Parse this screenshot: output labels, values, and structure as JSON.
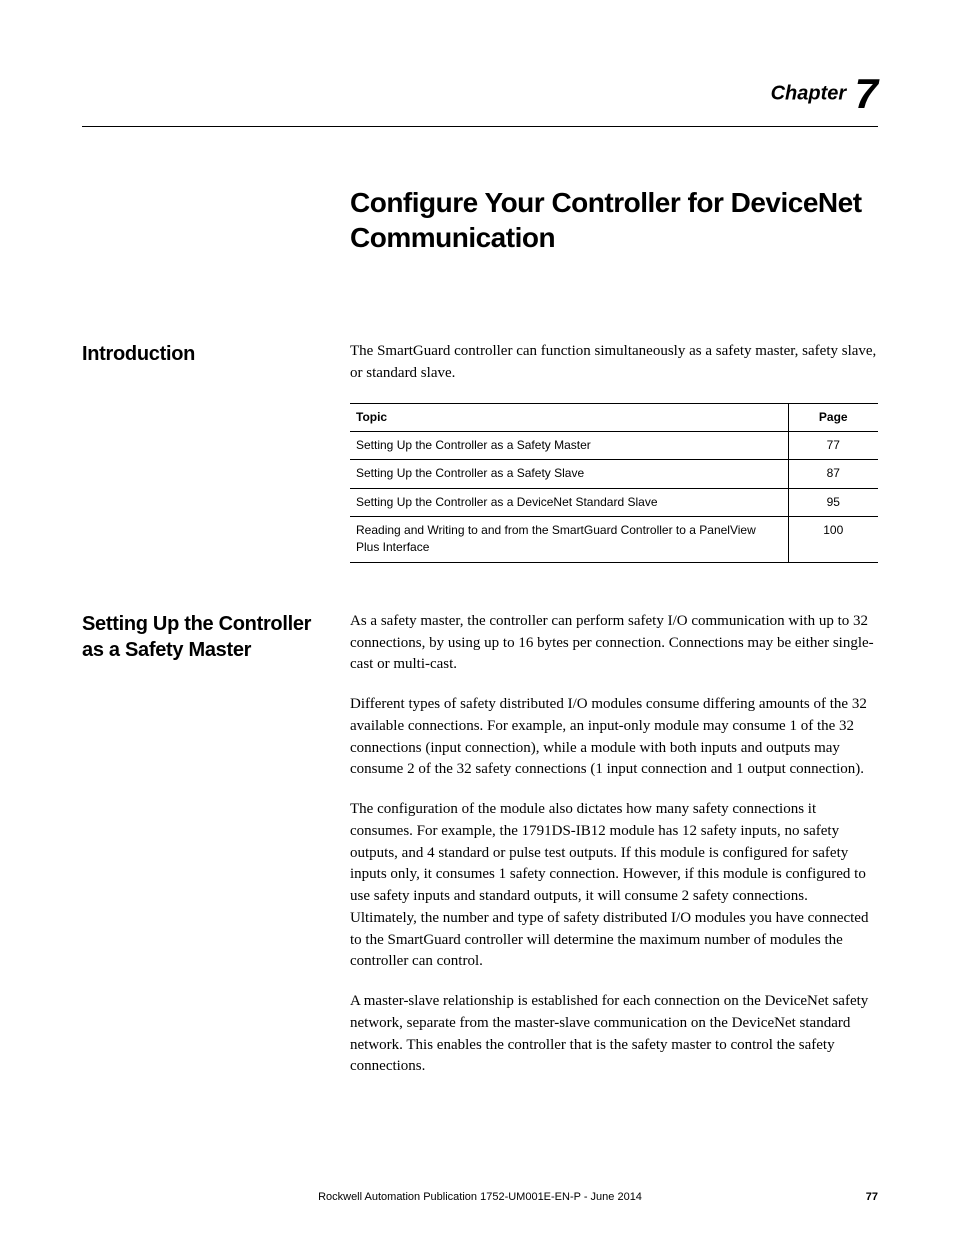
{
  "chapter": {
    "label": "Chapter",
    "number": "7"
  },
  "title": "Configure Your Controller for DeviceNet Communication",
  "intro": {
    "heading": "Introduction",
    "text": "The SmartGuard controller can function simultaneously as a safety master, safety slave, or standard slave.",
    "table": {
      "headers": {
        "topic": "Topic",
        "page": "Page"
      },
      "rows": [
        {
          "topic": "Setting Up the Controller as a Safety Master",
          "page": "77"
        },
        {
          "topic": "Setting Up the Controller as a Safety Slave",
          "page": "87"
        },
        {
          "topic": "Setting Up the Controller as a DeviceNet Standard Slave",
          "page": "95"
        },
        {
          "topic": "Reading and Writing to and from the SmartGuard Controller to a PanelView Plus Interface",
          "page": "100"
        }
      ]
    }
  },
  "section1": {
    "heading": "Setting Up the Controller as a Safety Master",
    "p1": "As a safety master, the controller can perform safety I/O communication with up to 32 connections, by using up to 16 bytes per connection. Connections may be either single-cast or multi-cast.",
    "p2": "Different types of safety distributed I/O modules consume differing amounts of the 32 available connections. For example, an input-only module may consume 1 of the 32 connections (input connection), while a module with both inputs and outputs may consume 2 of the 32 safety connections (1 input connection and 1 output connection).",
    "p3": "The configuration of the module also dictates how many safety connections it consumes. For example, the 1791DS-IB12 module has 12 safety inputs, no safety outputs, and 4 standard or pulse test outputs. If this module is configured for safety inputs only, it consumes 1 safety connection. However, if this module is configured to use safety inputs and standard outputs, it will consume 2 safety connections. Ultimately, the number and type of safety distributed I/O modules you have connected to the SmartGuard controller will determine the maximum number of modules the controller can control.",
    "p4": "A master-slave relationship is established for each connection on the DeviceNet safety network, separate from the master-slave communication on the DeviceNet standard network. This enables the controller that is the safety master to control the safety connections."
  },
  "footer": {
    "publication": "Rockwell Automation Publication 1752-UM001E-EN-P - June 2014",
    "page": "77"
  }
}
